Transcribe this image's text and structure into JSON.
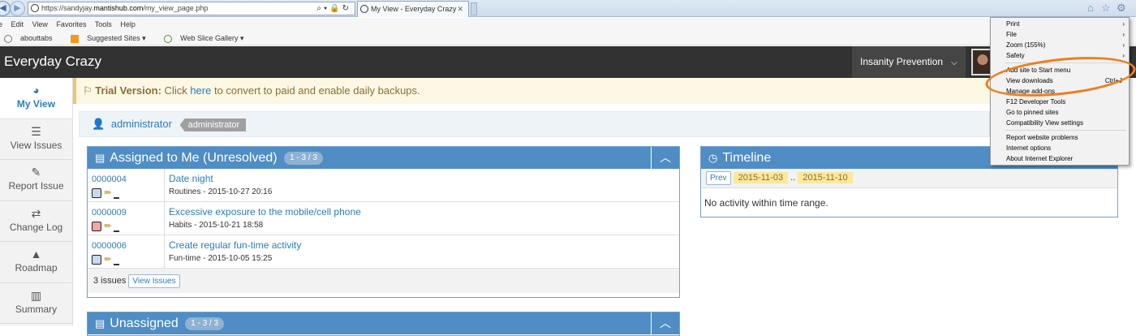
{
  "browser": {
    "url_prefix": "https://sandyjay.",
    "url_host": "mantishub.com",
    "url_path": "/my_view_page.php",
    "tab_title": "My View - Everyday Crazy",
    "tab_close": "✕",
    "menu": [
      "Edit",
      "View",
      "Favorites",
      "Tools",
      "Help"
    ],
    "favorites": [
      "abouttabs",
      "Suggested Sites ▾",
      "Web Slice Gallery ▾"
    ]
  },
  "tools_menu": {
    "items": [
      {
        "label": "Print",
        "arrow": "›"
      },
      {
        "label": "File",
        "arrow": "›"
      },
      {
        "label": "Zoom (155%)",
        "arrow": "›"
      },
      {
        "label": "Safety",
        "arrow": "›"
      },
      {
        "label": "Add site to Start menu"
      },
      {
        "label": "View downloads",
        "shortcut": "Ctrl+J"
      },
      {
        "label": "Manage add-ons"
      },
      {
        "label": "F12 Developer Tools"
      },
      {
        "label": "Go to pinned sites"
      },
      {
        "label": "Compatibility View settings"
      },
      {
        "label": "Report website problems"
      },
      {
        "label": "Internet options"
      },
      {
        "label": "About Internet Explorer"
      }
    ]
  },
  "app": {
    "title": "Everyday Crazy",
    "project": "Insanity Prevention"
  },
  "sidebar": {
    "items": [
      {
        "label": "My View",
        "icon": "dashboard-icon"
      },
      {
        "label": "View Issues",
        "icon": "list-icon"
      },
      {
        "label": "Report Issue",
        "icon": "edit-icon"
      },
      {
        "label": "Change Log",
        "icon": "retweet-icon"
      },
      {
        "label": "Roadmap",
        "icon": "road-icon"
      },
      {
        "label": "Summary",
        "icon": "bar-chart-icon"
      }
    ]
  },
  "trial": {
    "strong": "Trial Version:",
    "pre": " Click ",
    "link": "here",
    "post": " to convert to paid and enable daily backups."
  },
  "breadcrumb": {
    "user": "administrator",
    "role": "administrator"
  },
  "assigned": {
    "title": "Assigned to Me (Unresolved)",
    "badge": "1 - 3 / 3",
    "rows": [
      {
        "id": "0000004",
        "summary": "Date night",
        "meta": "Routines - 2015-10-27 20:16",
        "status_color": "#c8d8ee"
      },
      {
        "id": "0000009",
        "summary": "Excessive exposure to the mobile/cell phone",
        "meta": "Habits - 2015-10-21 18:58",
        "status_color": "#f5a3a3"
      },
      {
        "id": "0000006",
        "summary": "Create regular fun-time activity",
        "meta": "Fun-time - 2015-10-05 15:25",
        "status_color": "#c8d8ee"
      }
    ],
    "footer_count": "3 issues",
    "footer_button": "View Issues"
  },
  "unassigned": {
    "title": "Unassigned",
    "badge": "1 - 3 / 3"
  },
  "timeline": {
    "title": "Timeline",
    "prev": "Prev",
    "from": "2015-11-03",
    "sep": "..",
    "to": "2015-11-10",
    "empty": "No activity within time range."
  }
}
